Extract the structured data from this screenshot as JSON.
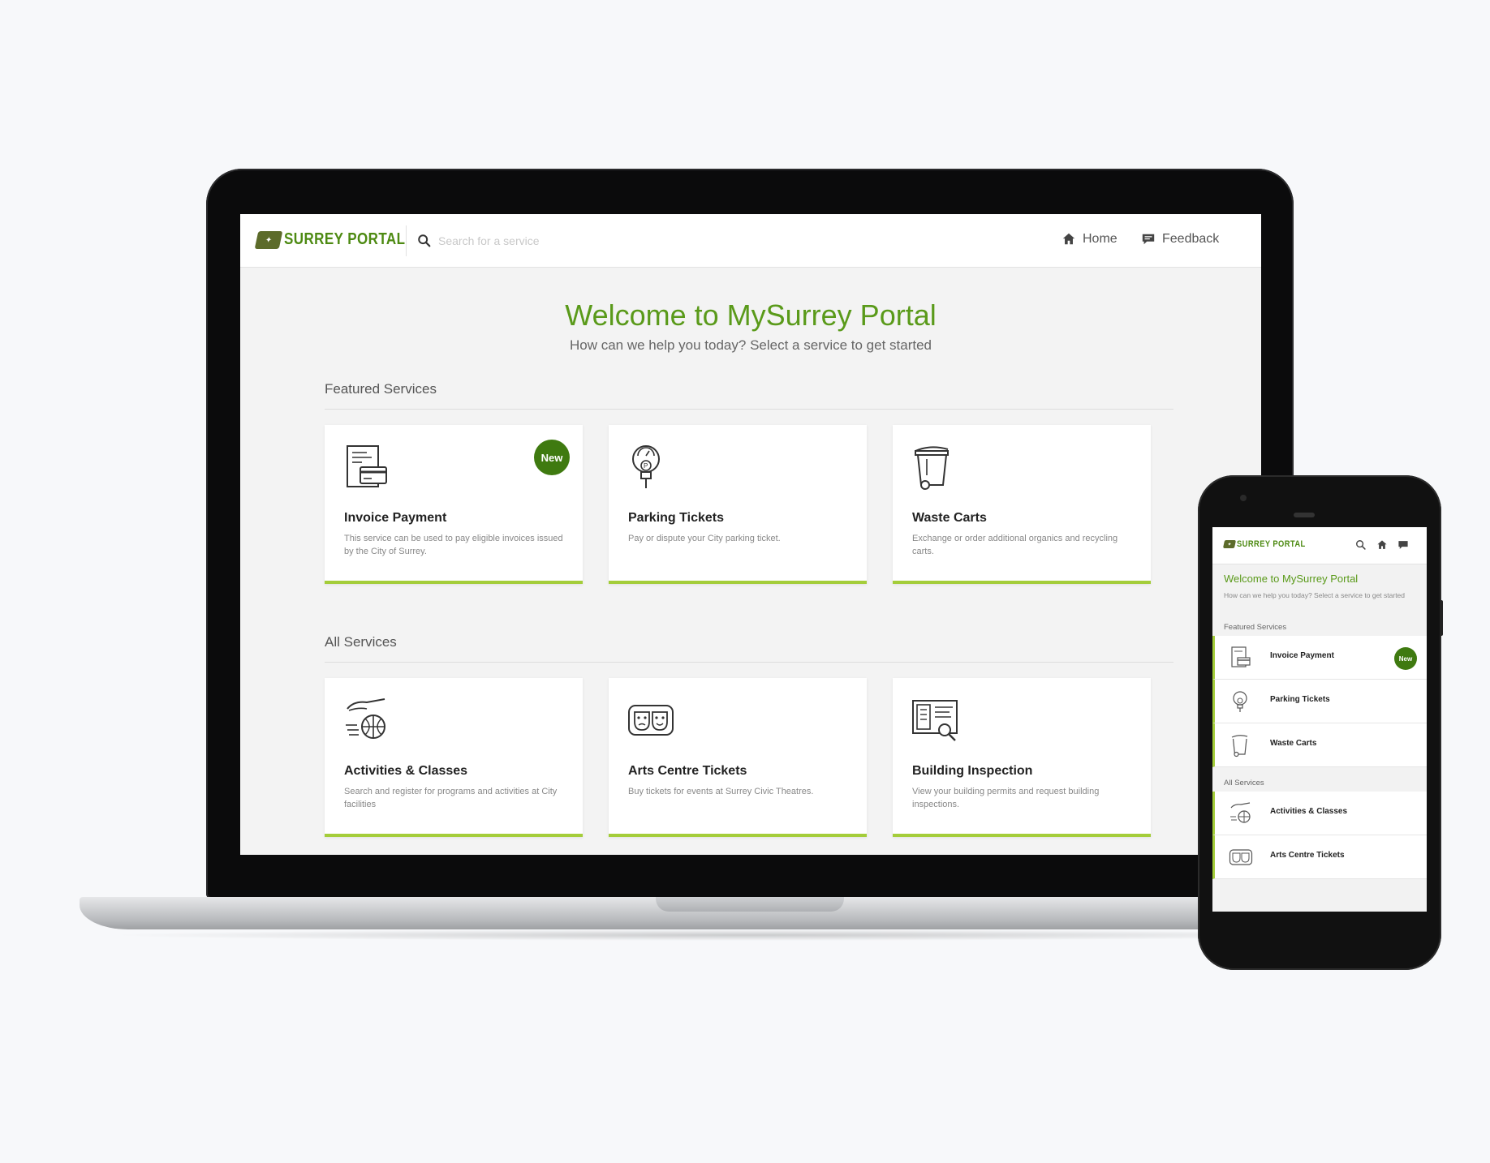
{
  "brand": {
    "logo_text": "SURREY PORTAL",
    "accent": "#5a9a1a",
    "badge_color": "#3f7a10",
    "card_underline": "#a4cd3a"
  },
  "header": {
    "search_placeholder": "Search for a service",
    "nav_home": "Home",
    "nav_feedback": "Feedback"
  },
  "main": {
    "title": "Welcome to MySurrey Portal",
    "subtitle": "How can we help you today? Select a service to get started"
  },
  "featured": {
    "heading": "Featured Services",
    "cards": [
      {
        "title": "Invoice Payment",
        "desc": "This service can be used to pay eligible invoices issued by the City of Surrey.",
        "badge": "New",
        "icon": "invoice-icon"
      },
      {
        "title": "Parking Tickets",
        "desc": "Pay or dispute your City parking ticket.",
        "icon": "parking-meter-icon"
      },
      {
        "title": "Waste Carts",
        "desc": "Exchange or order additional organics and recycling carts.",
        "icon": "waste-cart-icon"
      }
    ]
  },
  "all_services": {
    "heading": "All Services",
    "cards": [
      {
        "title": "Activities & Classes",
        "desc": "Search and register for programs and activities at City facilities",
        "icon": "activities-icon"
      },
      {
        "title": "Arts Centre Tickets",
        "desc": "Buy tickets for events at Surrey Civic Theatres.",
        "icon": "theatre-masks-icon"
      },
      {
        "title": "Building Inspection",
        "desc": "View your building permits and request building inspections.",
        "icon": "building-inspection-icon"
      }
    ]
  },
  "mobile": {
    "logo_text": "SURREY PORTAL",
    "title": "Welcome to MySurrey Portal",
    "subtitle": "How can we help you today? Select a service to get started",
    "featured_heading": "Featured Services",
    "featured_rows": [
      {
        "label": "Invoice Payment",
        "badge": "New"
      },
      {
        "label": "Parking Tickets"
      },
      {
        "label": "Waste Carts"
      }
    ],
    "all_heading": "All Services",
    "all_rows": [
      {
        "label": "Activities & Classes"
      },
      {
        "label": "Arts Centre Tickets"
      }
    ]
  }
}
